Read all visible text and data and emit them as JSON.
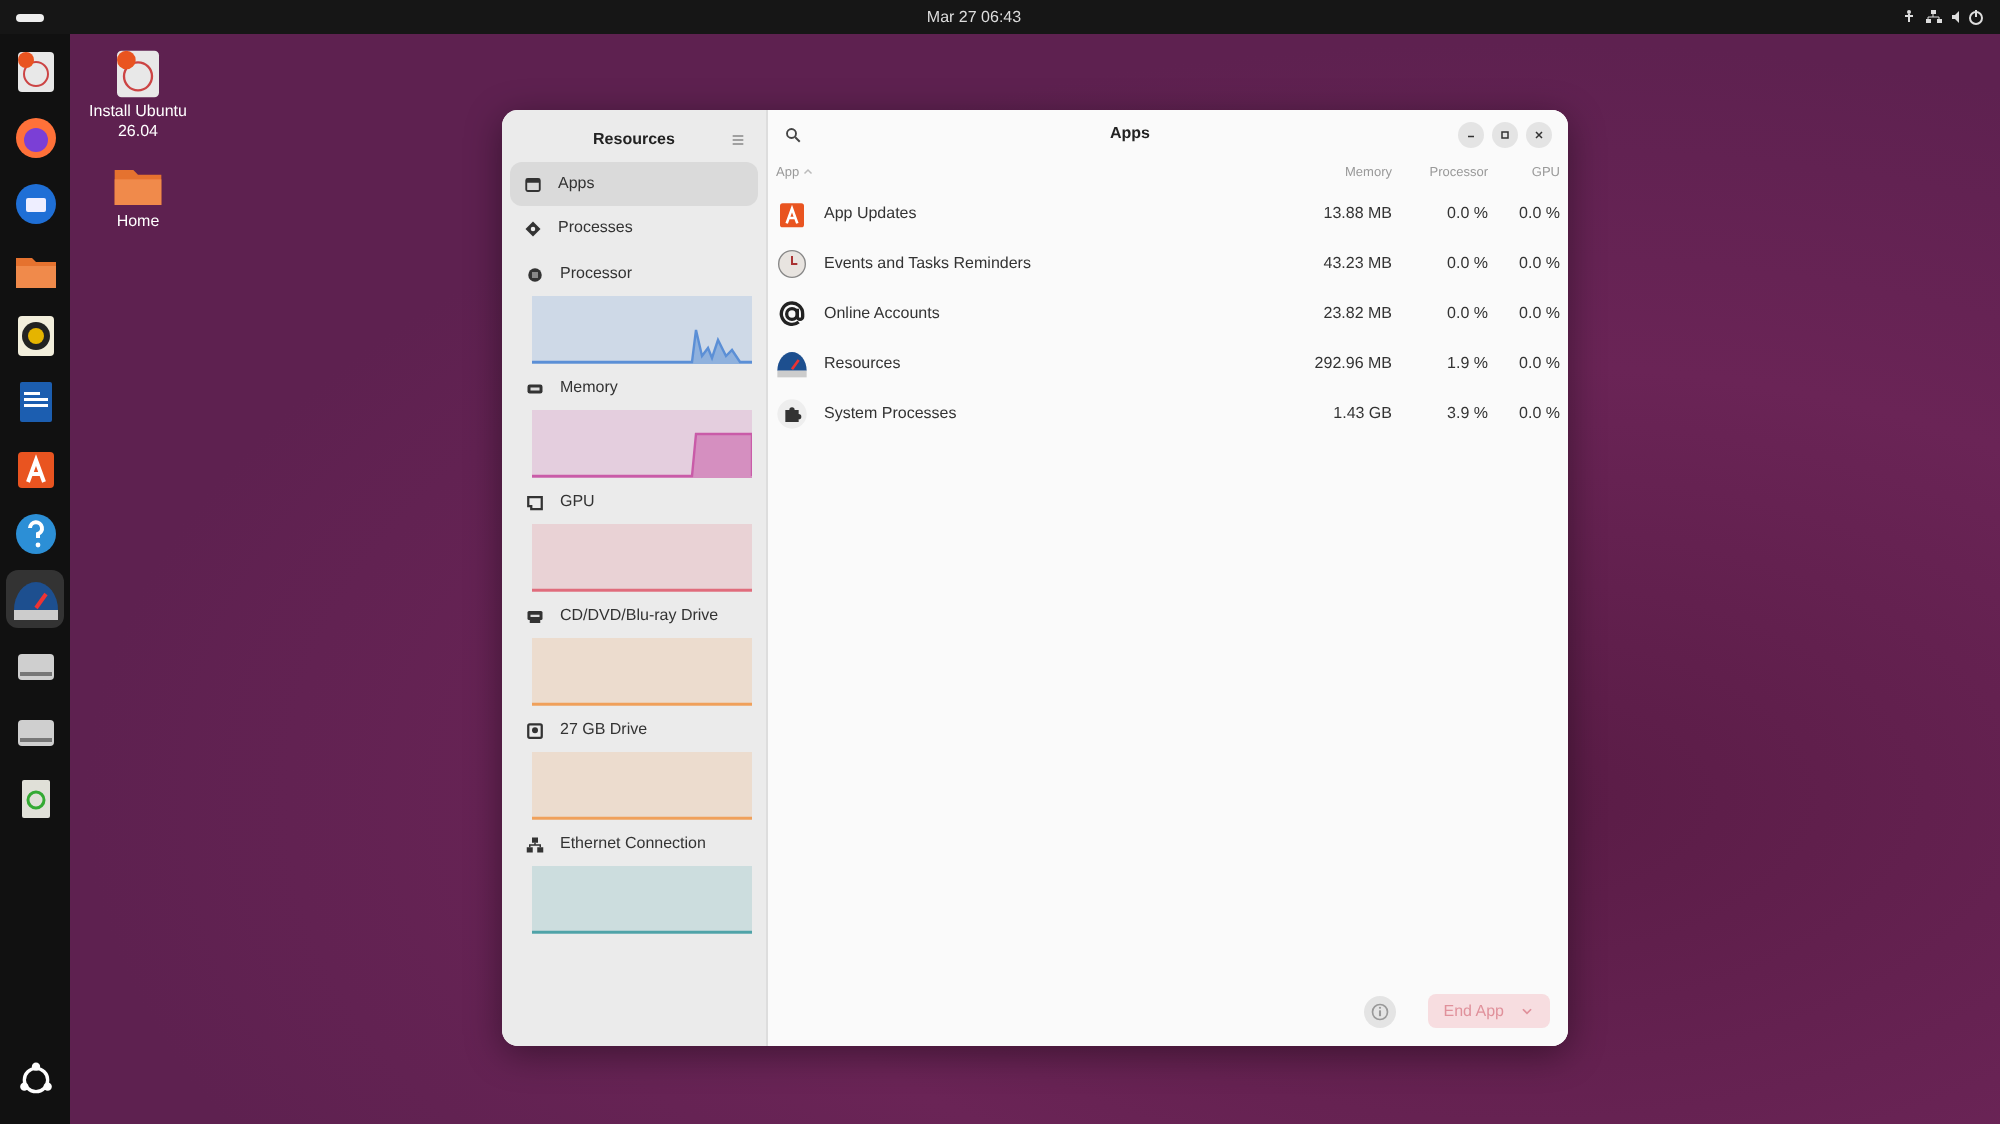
{
  "top_bar": {
    "clock": "Mar 27  06:43"
  },
  "dock": [
    {
      "kind": "installer",
      "selected": false
    },
    {
      "kind": "browser",
      "selected": false
    },
    {
      "kind": "mail",
      "selected": false
    },
    {
      "kind": "folder",
      "selected": false
    },
    {
      "kind": "speaker",
      "selected": false
    },
    {
      "kind": "document",
      "selected": false
    },
    {
      "kind": "store",
      "selected": false
    },
    {
      "kind": "help",
      "selected": false
    },
    {
      "kind": "gauge",
      "selected": true
    },
    {
      "kind": "drive",
      "selected": false
    },
    {
      "kind": "drive",
      "selected": false
    },
    {
      "kind": "trash",
      "selected": false
    }
  ],
  "desktop_icons": [
    {
      "kind": "installer",
      "label": "Install Ubuntu 26.04"
    },
    {
      "kind": "folder",
      "label": "Home"
    }
  ],
  "window": {
    "sidebar_title": "Resources",
    "title": "Apps",
    "nav": [
      {
        "kind": "apps",
        "label": "Apps",
        "selected": true
      },
      {
        "kind": "processes",
        "label": "Processes",
        "selected": false
      }
    ],
    "resources": [
      {
        "kind": "processor",
        "label": "Processor",
        "color": "#5b8fd6"
      },
      {
        "kind": "memory",
        "label": "Memory",
        "color": "#c95ba8"
      },
      {
        "kind": "gpu",
        "label": "GPU",
        "color": "#e06c7c"
      },
      {
        "kind": "disc",
        "label": "CD/DVD/Blu-ray Drive",
        "color": "#f0a05a"
      },
      {
        "kind": "drive",
        "label": "27 GB Drive",
        "color": "#f0a05a"
      },
      {
        "kind": "network",
        "label": "Ethernet Connection",
        "color": "#4fa3a8"
      }
    ],
    "columns": [
      {
        "label": "App",
        "sorted": true
      },
      {
        "label": "Memory",
        "sorted": false
      },
      {
        "label": "Processor",
        "sorted": false
      },
      {
        "label": "GPU",
        "sorted": false
      }
    ],
    "rows": [
      {
        "kind": "store",
        "app": "App Updates",
        "memory": "13.88 MB",
        "processor": "0.0 %",
        "gpu": "0.0 %"
      },
      {
        "kind": "clock",
        "app": "Events and Tasks Reminders",
        "memory": "43.23 MB",
        "processor": "0.0 %",
        "gpu": "0.0 %"
      },
      {
        "kind": "at",
        "app": "Online Accounts",
        "memory": "23.82 MB",
        "processor": "0.0 %",
        "gpu": "0.0 %"
      },
      {
        "kind": "gauge",
        "app": "Resources",
        "memory": "292.96 MB",
        "processor": "1.9 %",
        "gpu": "0.0 %"
      },
      {
        "kind": "puzzle",
        "app": "System Processes",
        "memory": "1.43 GB",
        "processor": "3.9 %",
        "gpu": "0.0 %"
      }
    ],
    "end_button": {
      "label": "End App",
      "disabled": true
    }
  }
}
